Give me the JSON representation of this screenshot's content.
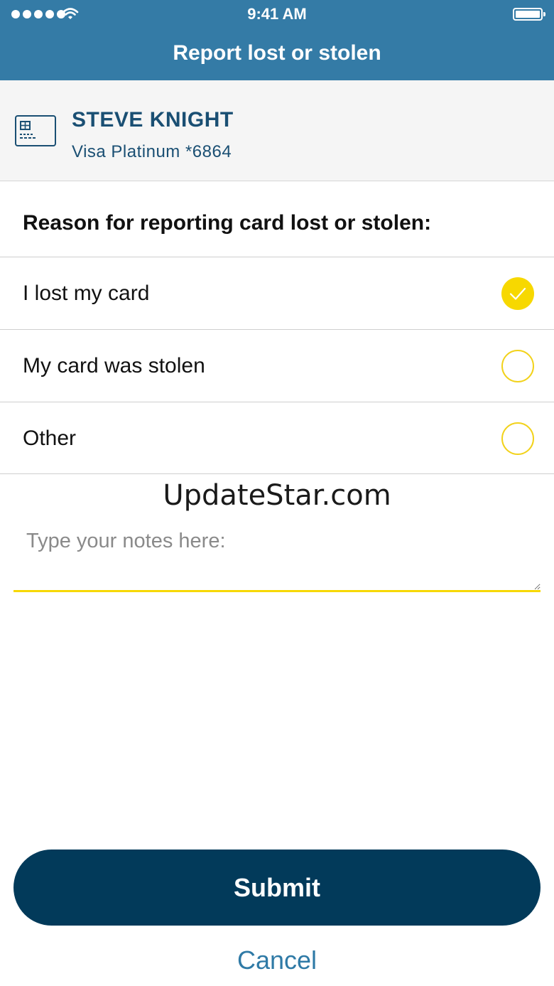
{
  "status_bar": {
    "time": "9:41 AM",
    "signal_icon": "signal-dots-icon",
    "wifi_icon": "wifi-icon",
    "battery_icon": "battery-icon"
  },
  "header": {
    "title": "Report lost or stolen",
    "background": "#347ba6"
  },
  "card": {
    "icon": "credit-card-icon",
    "holder_name": "STEVE KNIGHT",
    "description": "Visa Platinum *6864",
    "text_color": "#1a4f73"
  },
  "reason": {
    "heading": "Reason for reporting card lost or stolen:",
    "options": [
      {
        "label": "I lost my card",
        "selected": true
      },
      {
        "label": "My card was stolen",
        "selected": false
      },
      {
        "label": "Other",
        "selected": false
      }
    ],
    "accent": "#f7d800"
  },
  "watermark": "UpdateStar.com",
  "notes": {
    "placeholder": "Type your notes here:",
    "value": ""
  },
  "actions": {
    "submit_label": "Submit",
    "cancel_label": "Cancel",
    "submit_color": "#023a5a",
    "cancel_color": "#2f7aa6"
  }
}
